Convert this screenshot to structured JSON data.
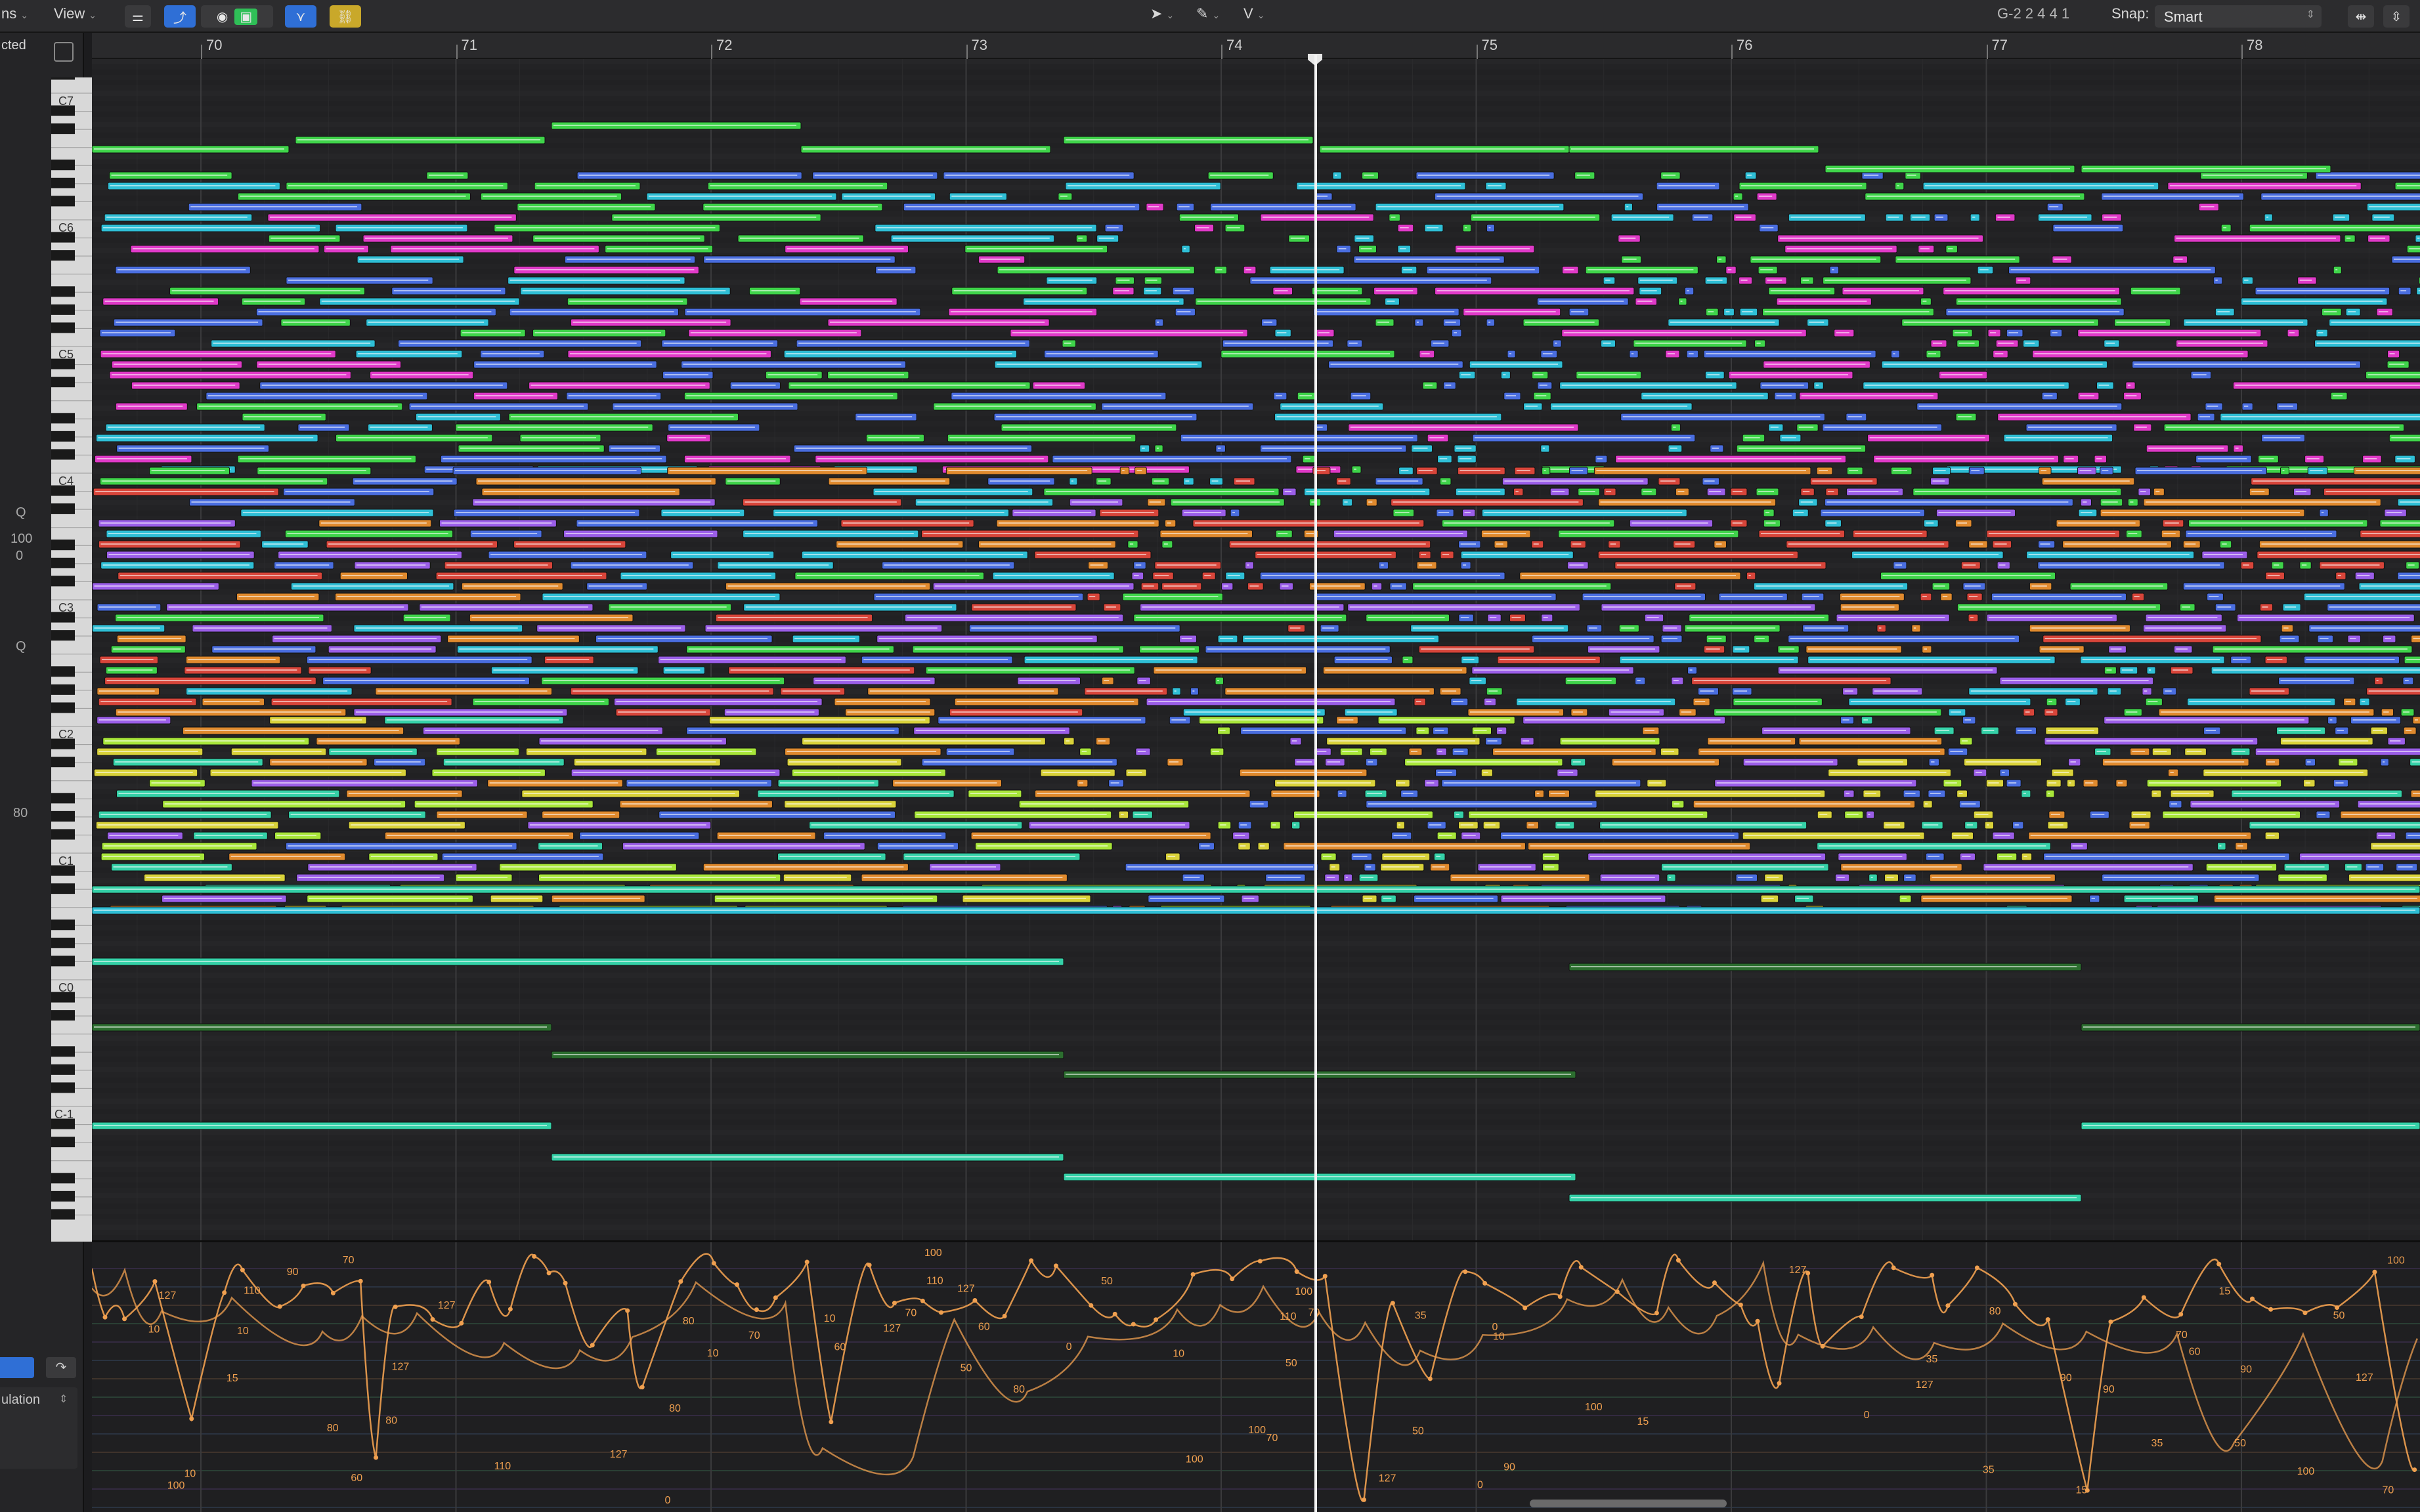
{
  "toolbar": {
    "menu_edit_suffix": "ns",
    "menu_view": "View",
    "position_display": "G-2   2 4 4 1",
    "snap_label": "Snap:",
    "snap_value": "Smart",
    "pointer_tool_icon": "arrow-pointer-icon",
    "pencil_tool_icon": "pencil-icon",
    "velocity_tool_label": "V"
  },
  "inspector": {
    "selection_label": "cted",
    "quantize_q1": "Q",
    "value_100": "100",
    "value_0": "0",
    "quantize_q2": "Q",
    "velocity_value": "80",
    "lane_label": "ulation"
  },
  "ruler": {
    "bars": [
      "70",
      "71",
      "72",
      "73",
      "74",
      "75",
      "76",
      "77",
      "78"
    ]
  },
  "keyboard": {
    "octave_labels": [
      "C7",
      "C6",
      "C5",
      "C4",
      "C3",
      "C2",
      "C1",
      "C0",
      "C-1"
    ]
  },
  "velocity_lane": {
    "value_labels": [
      "127",
      "110",
      "100",
      "90",
      "80",
      "70",
      "60",
      "50",
      "35",
      "15",
      "10",
      "0"
    ]
  },
  "colors": {
    "green": "#3fd44a",
    "lime": "#a8e63a",
    "cyan": "#2fbfd6",
    "teal": "#35d1a8",
    "blue": "#4a6ee0",
    "purple": "#9b5ee8",
    "magenta": "#e03ac8",
    "orange": "#e08a2e",
    "red": "#d8453a",
    "yellow": "#d9d23a",
    "dark_green": "#2c6e2f",
    "velocity_curve": "#f0a050"
  }
}
